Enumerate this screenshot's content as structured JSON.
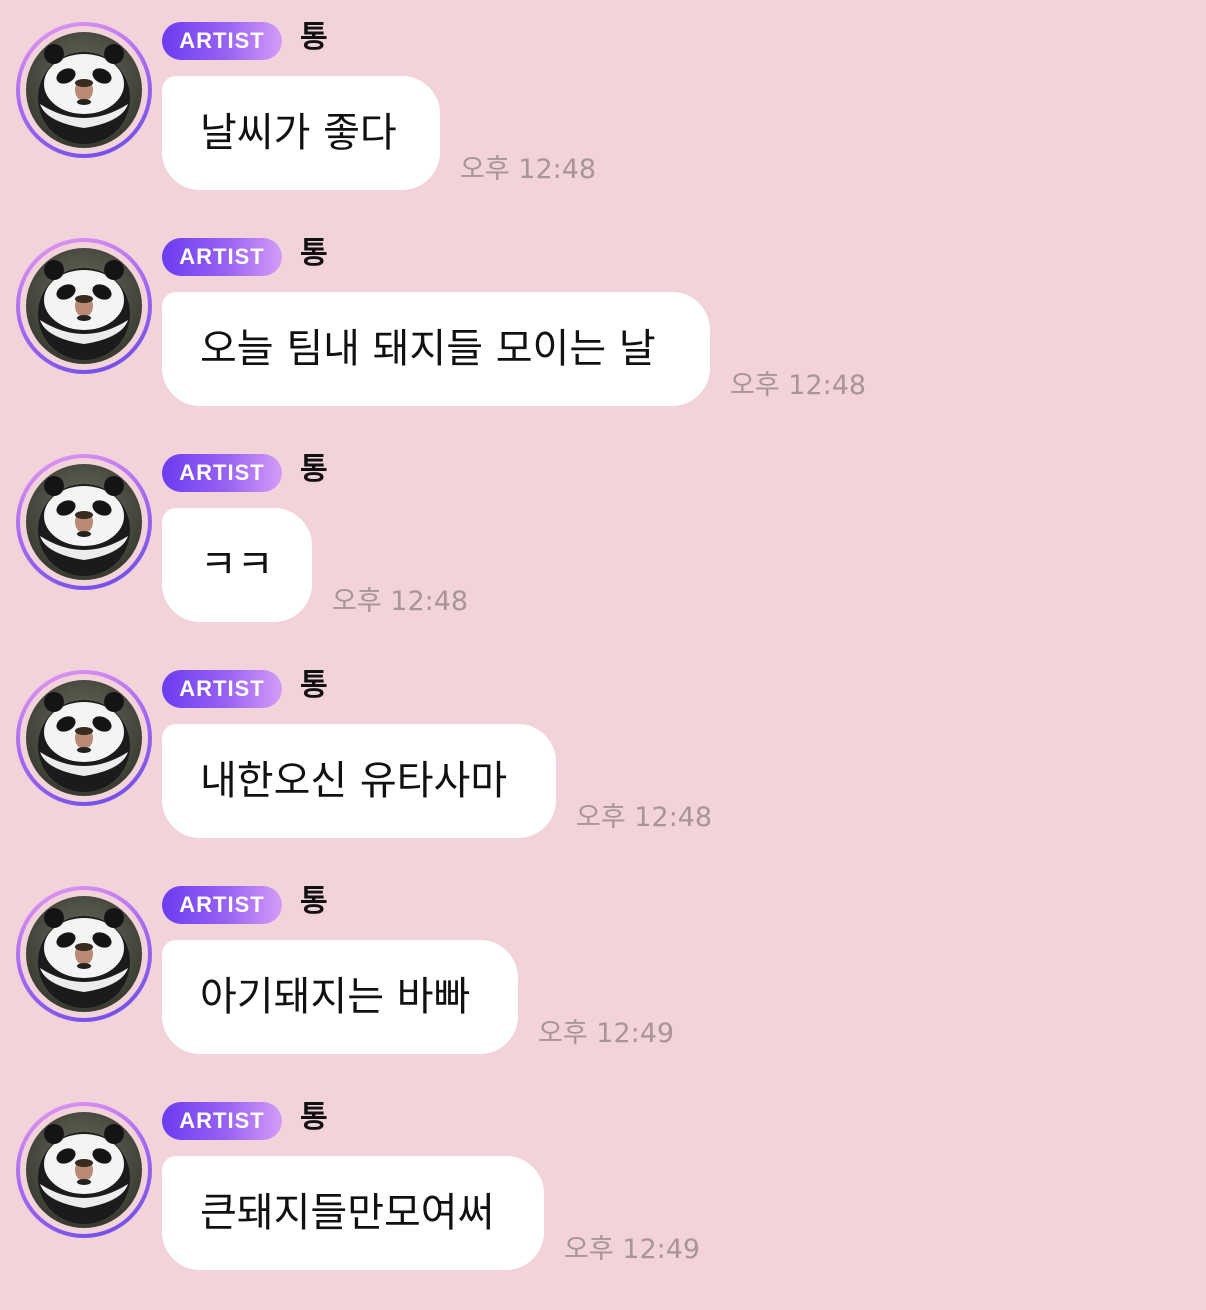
{
  "badge_label": "ARTIST",
  "sender": "통",
  "messages": [
    {
      "text": "날씨가 좋다",
      "time": "오후 12:48"
    },
    {
      "text": "오늘 팀내 돼지들 모이는 날",
      "time": "오후 12:48"
    },
    {
      "text": "ㅋㅋ",
      "time": "오후 12:48"
    },
    {
      "text": "내한오신 유타사마",
      "time": "오후 12:48"
    },
    {
      "text": "아기돼지는 바빠",
      "time": "오후 12:49"
    },
    {
      "text": "큰돼지들만모여써",
      "time": "오후 12:49"
    }
  ],
  "colors": {
    "background": "#f2d3d9",
    "bubble": "#ffffff",
    "badge_start": "#6b3cf0",
    "badge_end": "#d49cf6",
    "timestamp": "#a89499"
  },
  "avatar_icon": "panda-costume-avatar"
}
